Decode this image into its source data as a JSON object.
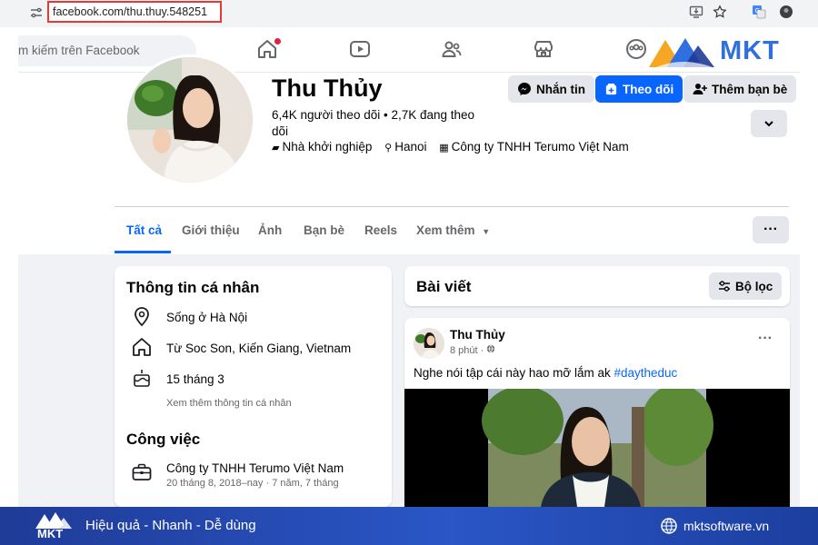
{
  "browser": {
    "url": "facebook.com/thu.thuy.548251"
  },
  "nav": {
    "search_placeholder": "m kiếm trên Facebook"
  },
  "logo": {
    "brand": "MKT",
    "colors": {
      "orange": "#f5a623",
      "blue": "#2f6fe0",
      "navy": "#1f3b97"
    }
  },
  "profile": {
    "name": "Thu Thủy",
    "followers_line1": "6,4K người theo dõi • 2,7K đang theo",
    "followers_line2": "dõi",
    "job": "Nhà khởi nghiệp",
    "location": "Hanoi",
    "company": "Công ty TNHH Terumo Việt Nam",
    "buttons": {
      "message": "Nhắn tin",
      "follow": "Theo dõi",
      "add_friend": "Thêm bạn bè"
    }
  },
  "tabs": {
    "all": "Tất cả",
    "about": "Giới thiệu",
    "photos": "Ảnh",
    "friends": "Bạn bè",
    "reels": "Reels",
    "more": "Xem thêm"
  },
  "info": {
    "title": "Thông tin cá nhân",
    "lives": "Sống ở Hà Nội",
    "from": "Từ Soc Son, Kiến Giang, Vietnam",
    "birthday": "15 tháng 3",
    "see_more": "Xem thêm thông tin cá nhân",
    "work_title": "Công việc",
    "work_company": "Công ty TNHH Terumo Việt Nam",
    "work_period": "20 tháng 8, 2018–nay · 7 năm, 7 tháng"
  },
  "posts": {
    "title": "Bài viết",
    "filter": "Bộ lọc",
    "author": "Thu Thủy",
    "time": "8 phút ·",
    "text": "Nghe nói tập cái này hao mỡ lắm ak ",
    "hashtag": "#daytheduc"
  },
  "banner": {
    "slogan": "Hiệu quả - Nhanh - Dễ dùng",
    "site": "mktsoftware.vn",
    "brand": "MKT"
  },
  "colors": {
    "fb_blue": "#0866ff",
    "notification_red": "#e41e3f",
    "url_highlight": "#e53935"
  }
}
